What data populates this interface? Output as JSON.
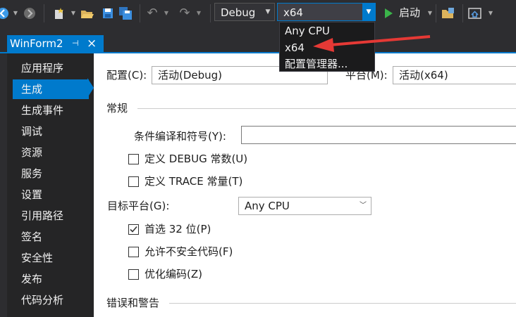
{
  "toolbar": {
    "config_value": "Debug",
    "platform_value": "x64",
    "start_label": "启动"
  },
  "platform_dropdown": {
    "options": [
      "Any CPU",
      "x64",
      "配置管理器..."
    ]
  },
  "tab": {
    "title": "WinForm2",
    "pin_glyph": "⊣",
    "close_glyph": "×"
  },
  "sidebar": {
    "items": [
      "应用程序",
      "生成",
      "生成事件",
      "调试",
      "资源",
      "服务",
      "设置",
      "引用路径",
      "签名",
      "安全性",
      "发布",
      "代码分析"
    ],
    "active_index": 1
  },
  "config_row": {
    "config_label": "配置(C):",
    "config_value": "活动(Debug)",
    "platform_label": "平台(M):",
    "platform_value": "活动(x64)"
  },
  "general": {
    "heading": "常规",
    "symbols_label": "条件编译和符号(Y):",
    "symbols_value": "",
    "define_debug_label": "定义 DEBUG 常数(U)",
    "define_debug_checked": false,
    "define_trace_label": "定义 TRACE 常量(T)",
    "define_trace_checked": false,
    "target_platform_label": "目标平台(G):",
    "target_platform_value": "Any CPU",
    "prefer32_label": "首选 32 位(P)",
    "prefer32_checked": true,
    "unsafe_label": "允许不安全代码(F)",
    "unsafe_checked": false,
    "optimize_label": "优化编码(Z)",
    "optimize_checked": false
  },
  "errors": {
    "heading": "错误和警告"
  },
  "colors": {
    "accent": "#007acc",
    "annotation": "#e53935",
    "play": "#3bb44a"
  },
  "icons": [
    "nav-back-icon",
    "nav-forward-icon",
    "new-project-icon",
    "open-folder-icon",
    "save-icon",
    "save-all-icon",
    "undo-icon",
    "redo-icon",
    "start-icon",
    "find-in-files-icon",
    "home-window-icon"
  ]
}
